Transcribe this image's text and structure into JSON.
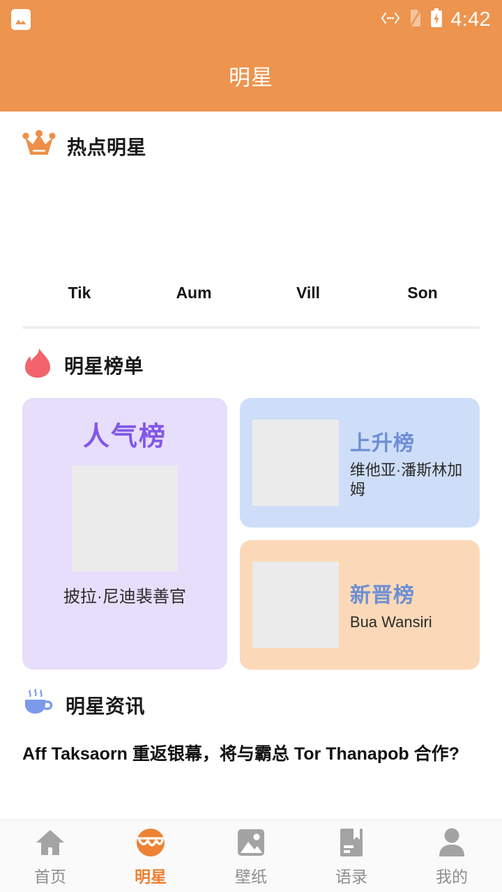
{
  "statusbar": {
    "notification_icon": "gallery-icon",
    "vpn_icon": "vpn-icon",
    "sim_icon": "no-sim-icon",
    "battery_icon": "battery-charging-icon",
    "time": "4:42"
  },
  "appbar": {
    "title": "明星"
  },
  "hot_stars": {
    "icon": "crown-icon",
    "heading": "热点明星",
    "items": [
      {
        "name": "Tik"
      },
      {
        "name": "Aum"
      },
      {
        "name": "Vill"
      },
      {
        "name": "Son"
      }
    ]
  },
  "rankings": {
    "icon": "flame-icon",
    "heading": "明星榜单",
    "popularity": {
      "title": "人气榜",
      "name": "披拉·尼迪裴善官",
      "bg_color": "#E7DEFB",
      "title_color": "#8257E6"
    },
    "rising": {
      "title": "上升榜",
      "name": "维他亚·潘斯林加姆",
      "bg_color": "#CEDEF8",
      "title_color": "#6D8FD4"
    },
    "newcomer": {
      "title": "新晋榜",
      "name": "Bua Wansiri",
      "bg_color": "#FBD9B8",
      "title_color": "#6D8FD4"
    }
  },
  "news": {
    "icon": "coffee-cup-icon",
    "heading": "明星资讯",
    "headline": "Aff Taksaorn 重返银幕，将与霸总 Tor Thanapob 合作?"
  },
  "bottom_nav": {
    "active_color": "#ED7F32",
    "inactive_color": "#8e8e8e",
    "items": [
      {
        "label": "首页",
        "icon": "home-icon"
      },
      {
        "label": "明星",
        "icon": "star-face-icon"
      },
      {
        "label": "壁纸",
        "icon": "image-icon"
      },
      {
        "label": "语录",
        "icon": "book-bookmark-icon"
      },
      {
        "label": "我的",
        "icon": "person-icon"
      }
    ]
  },
  "theme": {
    "header_color": "#ED944F",
    "accent": "#ED7F32"
  }
}
